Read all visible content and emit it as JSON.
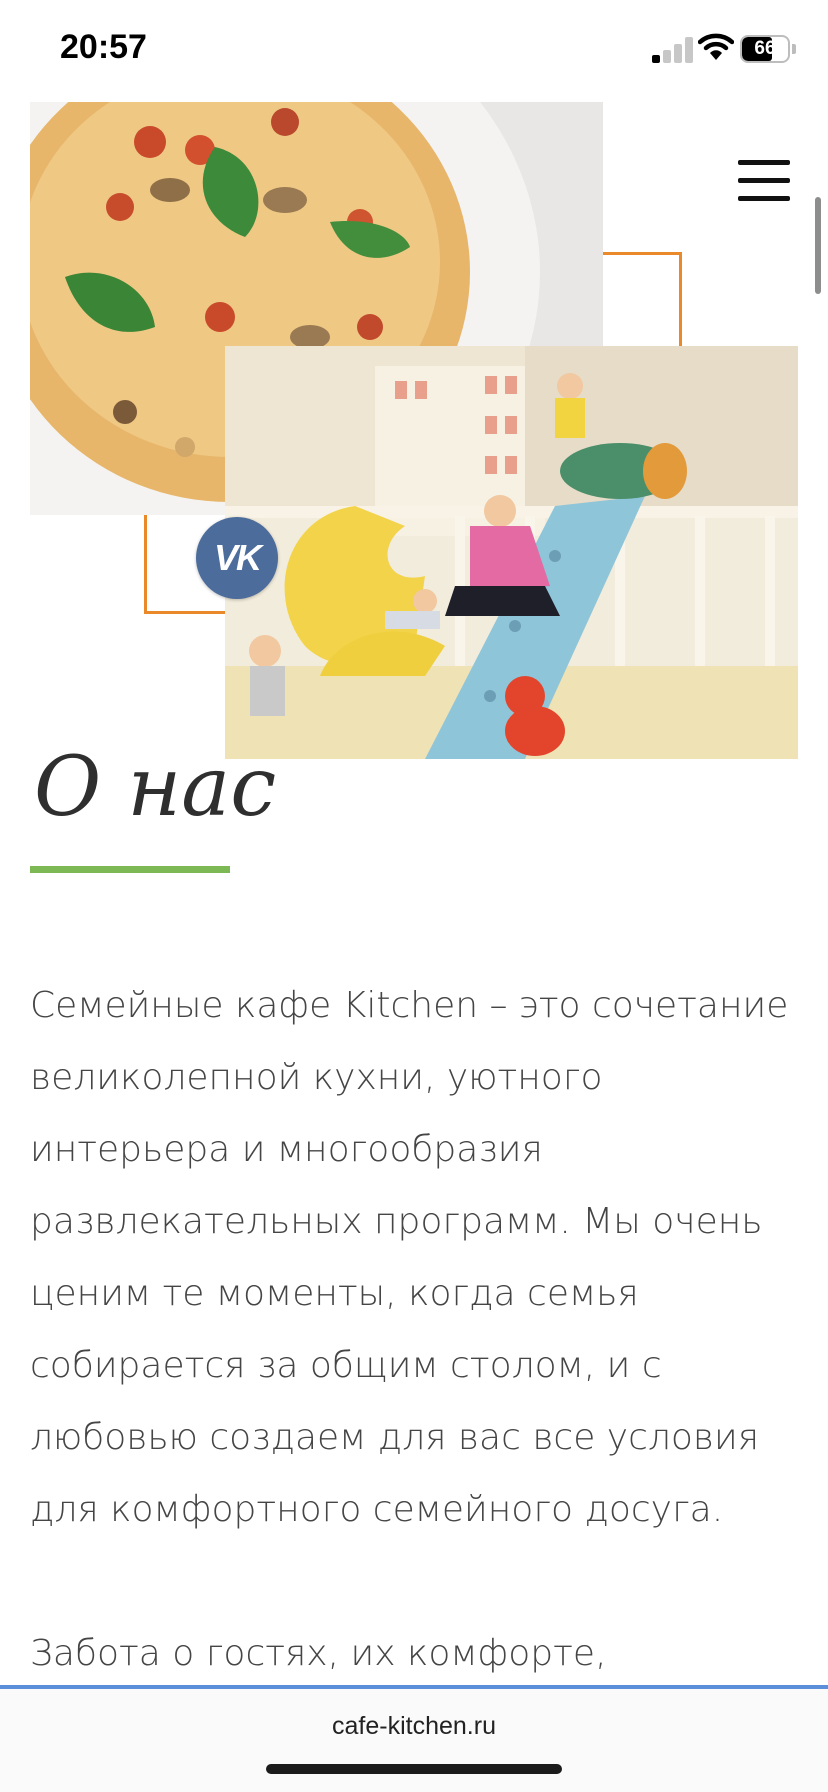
{
  "status_bar": {
    "time": "20:57",
    "battery_level": "66",
    "battery_fraction": 0.66,
    "signal_bars_active": 1,
    "signal_bars_total": 4
  },
  "header": {
    "menu_icon": "hamburger-icon"
  },
  "hero": {
    "vk_label": "VK",
    "accent_color": "#e9892a"
  },
  "about": {
    "title": "О нас",
    "underline_color": "#7cb955",
    "paragraph_1": "Семейные кафе Kitchen – это сочетание великолепной кухни, уютного интерьера и многообразия развлекательных программ. Мы очень ценим те моменты, когда семья собирается за общим столом, и с любовью создаем для вас все условия для комфортного семейного досуга.",
    "paragraph_2": "Забота о гостях, их комфорте,"
  },
  "browser": {
    "url": "cafe-kitchen.ru"
  }
}
